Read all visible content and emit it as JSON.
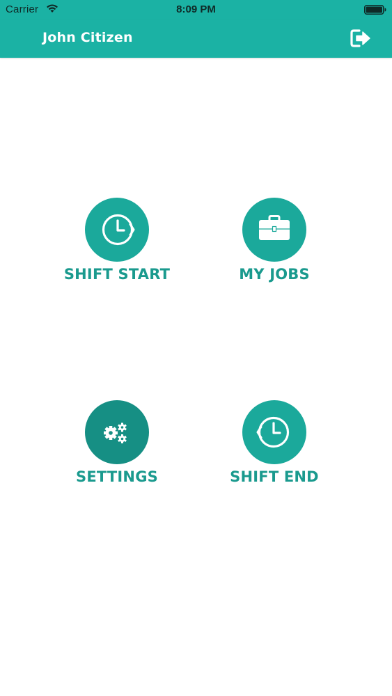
{
  "status_bar": {
    "carrier": "Carrier",
    "time": "8:09 PM"
  },
  "header": {
    "title": "John Citizen",
    "logout_icon": "sign-out-icon"
  },
  "tiles": [
    {
      "label": "SHIFT START",
      "icon": "clock-forward-icon"
    },
    {
      "label": "MY JOBS",
      "icon": "briefcase-icon"
    },
    {
      "label": "SETTINGS",
      "icon": "gears-icon"
    },
    {
      "label": "SHIFT END",
      "icon": "clock-back-icon"
    }
  ],
  "colors": {
    "brand": "#1bb2a4",
    "tile_circle": "#1ba99b",
    "tile_circle_active": "#168f84",
    "label_text": "#1a9a8e"
  }
}
